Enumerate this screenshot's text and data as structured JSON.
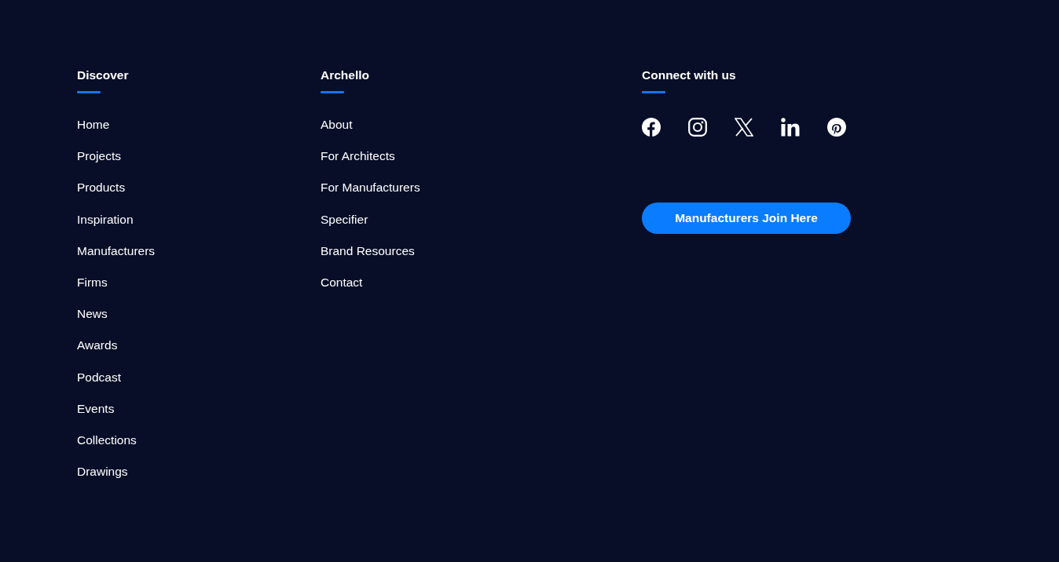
{
  "columns": [
    {
      "heading": "Discover",
      "links": [
        "Home",
        "Projects",
        "Products",
        "Inspiration",
        "Manufacturers",
        "Firms",
        "News",
        "Awards",
        "Podcast",
        "Events",
        "Collections",
        "Drawings"
      ]
    },
    {
      "heading": "Archello",
      "links": [
        "About",
        "For Architects",
        "For Manufacturers",
        "Specifier",
        "Brand Resources",
        "Contact"
      ]
    }
  ],
  "connect": {
    "heading": "Connect with us",
    "socials": [
      {
        "kind": "facebook"
      },
      {
        "kind": "instagram"
      },
      {
        "kind": "x"
      },
      {
        "kind": "linkedin"
      },
      {
        "kind": "pinterest"
      }
    ],
    "button": "Manufacturers Join Here"
  }
}
